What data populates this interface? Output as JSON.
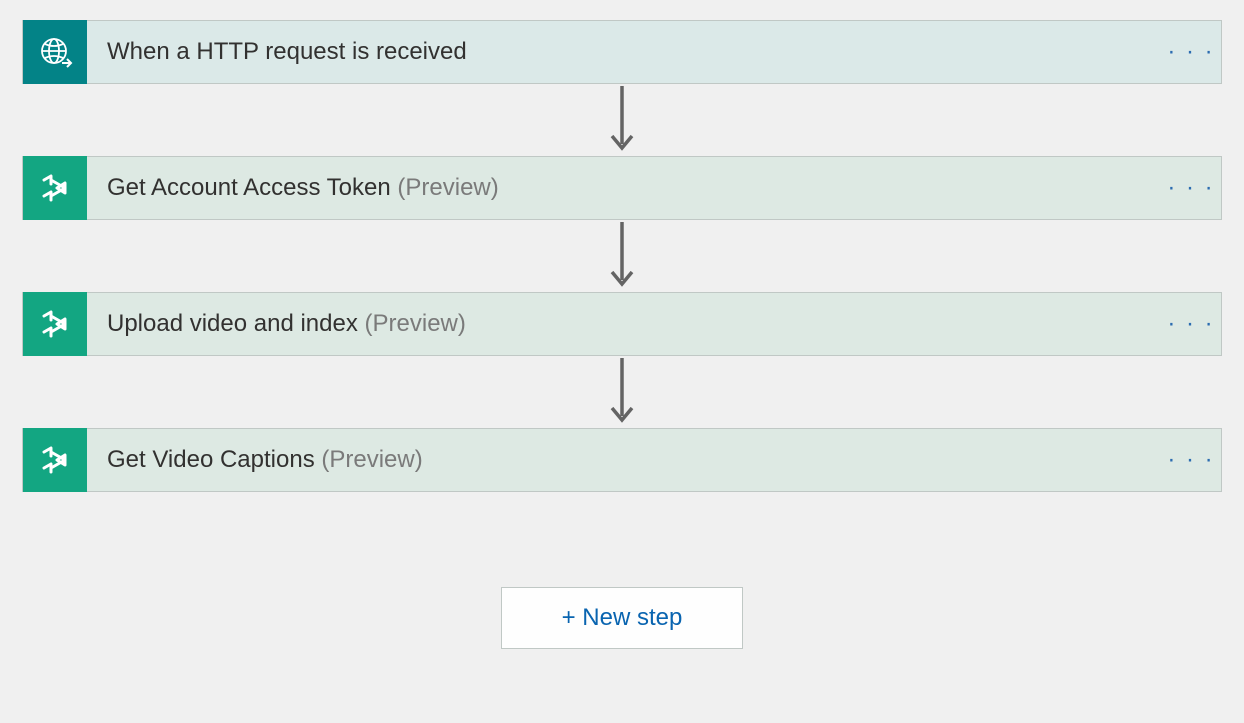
{
  "steps": [
    {
      "label": "When a HTTP request is received",
      "preview": "",
      "iconType": "globe",
      "iconBg": "teal",
      "cardBg": "teal-dark"
    },
    {
      "label": "Get Account Access Token",
      "preview": "(Preview)",
      "iconType": "play",
      "iconBg": "green",
      "cardBg": "teal-light"
    },
    {
      "label": "Upload video and index",
      "preview": "(Preview)",
      "iconType": "play",
      "iconBg": "green",
      "cardBg": "teal-light"
    },
    {
      "label": "Get Video Captions",
      "preview": "(Preview)",
      "iconType": "play",
      "iconBg": "green",
      "cardBg": "teal-light"
    }
  ],
  "newStepLabel": "+ New step",
  "menuDots": "· · ·"
}
